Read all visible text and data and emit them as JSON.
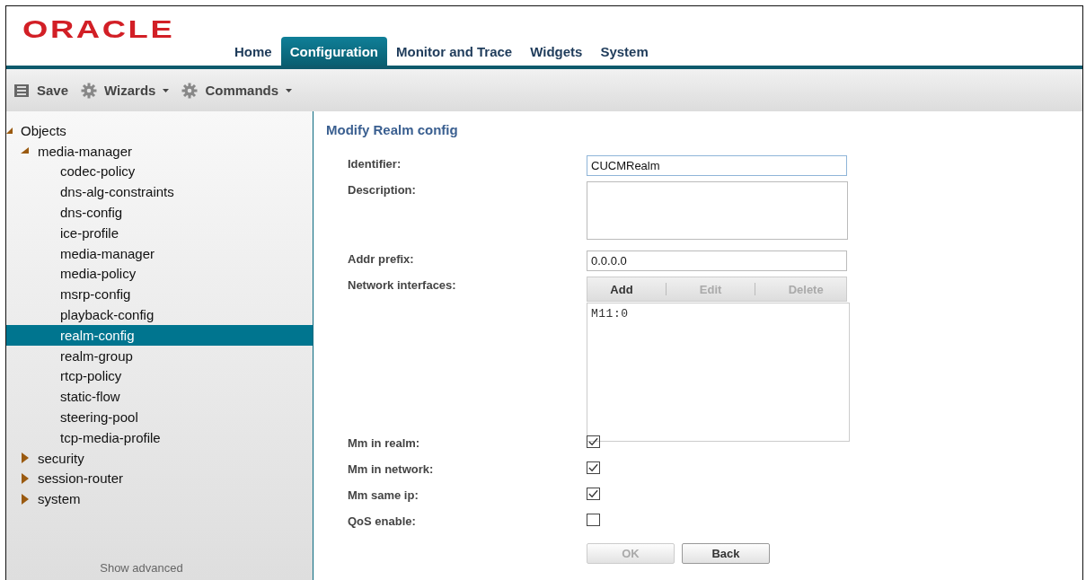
{
  "logo": "ORACLE",
  "tabs": [
    {
      "label": "Home",
      "selected": false
    },
    {
      "label": "Configuration",
      "selected": true
    },
    {
      "label": "Monitor and Trace",
      "selected": false
    },
    {
      "label": "Widgets",
      "selected": false
    },
    {
      "label": "System",
      "selected": false
    }
  ],
  "toolbar": [
    {
      "kind": "save",
      "label": "Save",
      "menu": false
    },
    {
      "kind": "gear",
      "label": "Wizards",
      "menu": true
    },
    {
      "kind": "gear",
      "label": "Commands",
      "menu": true
    }
  ],
  "tree": [
    {
      "label": "Objects",
      "expanded": true,
      "selected": false,
      "children": [
        {
          "label": "media-manager",
          "expanded": true,
          "selected": false,
          "children": [
            {
              "label": "codec-policy",
              "selected": false
            },
            {
              "label": "dns-alg-constraints",
              "selected": false
            },
            {
              "label": "dns-config",
              "selected": false
            },
            {
              "label": "ice-profile",
              "selected": false
            },
            {
              "label": "media-manager",
              "selected": false
            },
            {
              "label": "media-policy",
              "selected": false
            },
            {
              "label": "msrp-config",
              "selected": false
            },
            {
              "label": "playback-config",
              "selected": false
            },
            {
              "label": "realm-config",
              "selected": true
            },
            {
              "label": "realm-group",
              "selected": false
            },
            {
              "label": "rtcp-policy",
              "selected": false
            },
            {
              "label": "static-flow",
              "selected": false
            },
            {
              "label": "steering-pool",
              "selected": false
            },
            {
              "label": "tcp-media-profile",
              "selected": false
            }
          ]
        },
        {
          "label": "security",
          "expanded": false,
          "selected": false
        },
        {
          "label": "session-router",
          "expanded": false,
          "selected": false
        },
        {
          "label": "system",
          "expanded": false,
          "selected": false
        }
      ]
    }
  ],
  "show_advanced": "Show advanced",
  "form": {
    "title": "Modify Realm config",
    "fields": [
      {
        "kind": "text",
        "label": "Identifier:",
        "value": "CUCMRealm",
        "focused": true
      },
      {
        "kind": "textarea",
        "label": "Description:"
      },
      {
        "kind": "text",
        "label": "Addr prefix:",
        "value": "0.0.0.0",
        "focused": false
      },
      {
        "kind": "list",
        "label": "Network interfaces:",
        "actions": [
          {
            "label": "Add",
            "disabled": false
          },
          {
            "label": "Edit",
            "disabled": true
          },
          {
            "label": "Delete",
            "disabled": true
          }
        ],
        "items": [
          "M11:0"
        ]
      },
      {
        "kind": "checkbox",
        "label": "Mm in realm:",
        "checked": true
      },
      {
        "kind": "checkbox",
        "label": "Mm in network:",
        "checked": true
      },
      {
        "kind": "checkbox",
        "label": "Mm same ip:",
        "checked": true
      },
      {
        "kind": "checkbox",
        "label": "QoS enable:",
        "checked": false
      }
    ],
    "buttons": [
      {
        "label": "OK",
        "disabled": true
      },
      {
        "label": "Back",
        "disabled": false
      }
    ]
  }
}
